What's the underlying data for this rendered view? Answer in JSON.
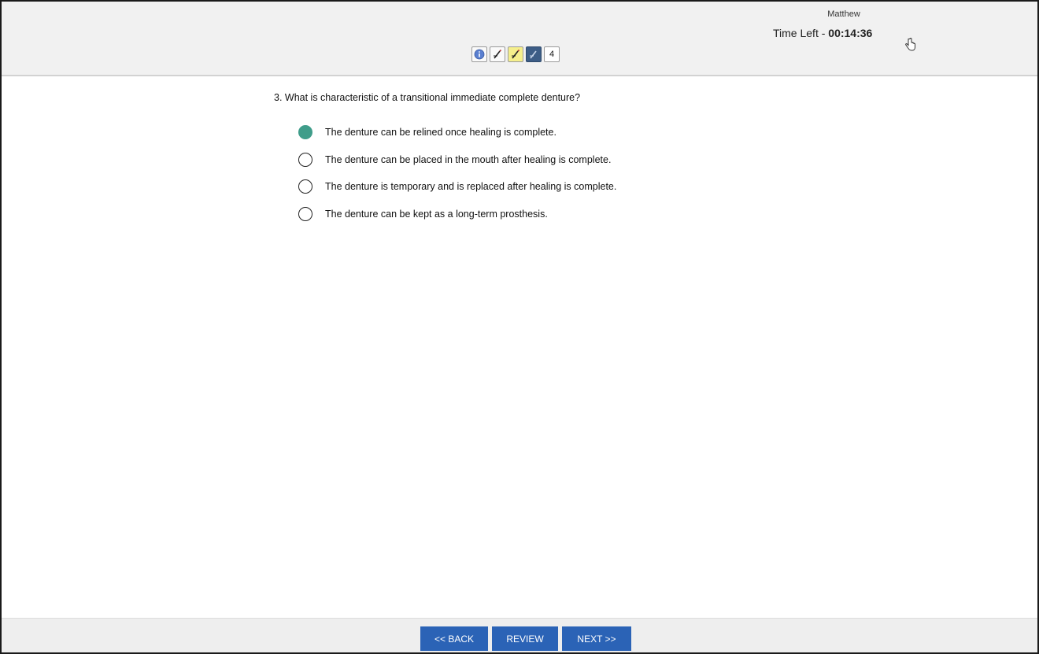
{
  "header": {
    "user_name": "Matthew",
    "time_left_label": "Time Left - ",
    "time_left_value": "00:14:36",
    "toolbar": {
      "icons": [
        "info-icon",
        "strikethrough-pen-icon",
        "highlighter-icon",
        "calculator-icon"
      ],
      "count": "4"
    }
  },
  "question": {
    "text": "3. What is characteristic of a transitional immediate complete denture?",
    "options": [
      {
        "label": "The denture can be relined once healing is complete.",
        "selected": true
      },
      {
        "label": "The denture can be placed in the mouth after healing is complete.",
        "selected": false
      },
      {
        "label": "The denture is temporary and is replaced after healing is complete.",
        "selected": false
      },
      {
        "label": "The denture can be kept as a long-term prosthesis.",
        "selected": false
      }
    ]
  },
  "footer": {
    "back_label": "<< BACK",
    "review_label": "REVIEW",
    "next_label": "NEXT >>"
  },
  "colors": {
    "selected_radio": "#3f9d8a",
    "nav_button": "#2b63b6",
    "header_bg": "#f1f1f1"
  }
}
